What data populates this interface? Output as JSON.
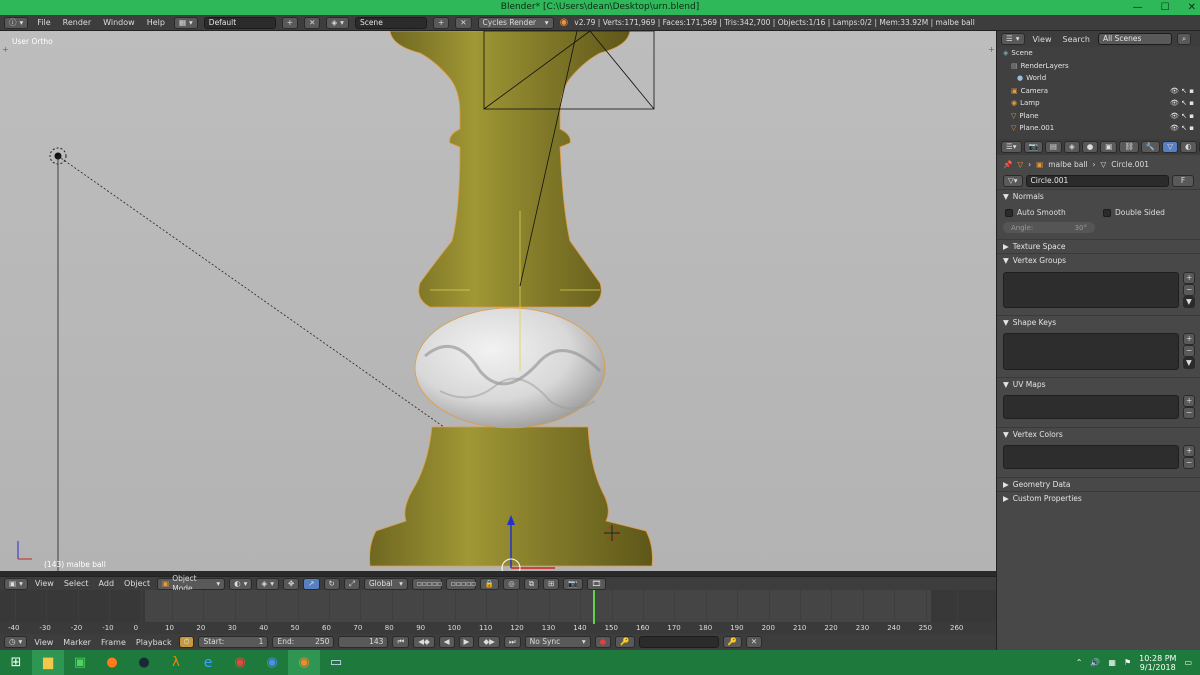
{
  "window": {
    "title": "Blender* [C:\\Users\\dean\\Desktop\\urn.blend]",
    "minimize": "—",
    "maximize": "☐",
    "close": "✕"
  },
  "infobar": {
    "menus": [
      "File",
      "Render",
      "Window",
      "Help"
    ],
    "layout": "Default",
    "scene": "Scene",
    "engine": "Cycles Render",
    "stats": "v2.79 | Verts:171,969 | Faces:171,569 | Tris:342,700 | Objects:1/16 | Lamps:0/2 | Mem:33.92M | malbe ball"
  },
  "viewport": {
    "view_label": "User Ortho",
    "object_label": "(143) malbe ball"
  },
  "outliner": {
    "view": "View",
    "search": "Search",
    "filter": "All Scenes",
    "items": [
      "Scene",
      "RenderLayers",
      "World",
      "Camera",
      "Lamp",
      "Plane",
      "Plane.001"
    ]
  },
  "properties": {
    "breadcrumb_object": "malbe ball",
    "breadcrumb_data": "Circle.001",
    "data_name": "Circle.001",
    "fake_user": "F",
    "normals": "Normals",
    "auto_smooth": "Auto Smooth",
    "double_sided": "Double Sided",
    "angle_label": "Angle:",
    "angle_value": "30°",
    "texture_space": "Texture Space",
    "vertex_groups": "Vertex Groups",
    "shape_keys": "Shape Keys",
    "uv_maps": "UV Maps",
    "vertex_colors": "Vertex Colors",
    "geometry_data": "Geometry Data",
    "custom_properties": "Custom Properties"
  },
  "viewport_header": {
    "menus": [
      "View",
      "Select",
      "Add",
      "Object"
    ],
    "mode": "Object Mode",
    "orientation": "Global"
  },
  "timeline": {
    "ticks": [
      "-40",
      "-30",
      "-20",
      "-10",
      "0",
      "10",
      "20",
      "30",
      "40",
      "50",
      "60",
      "70",
      "80",
      "90",
      "100",
      "110",
      "120",
      "130",
      "140",
      "150",
      "160",
      "170",
      "180",
      "190",
      "200",
      "210",
      "220",
      "230",
      "240",
      "250",
      "260"
    ],
    "current_frame_marker": 143
  },
  "timeline_header": {
    "menus": [
      "View",
      "Marker",
      "Frame",
      "Playback"
    ],
    "start_label": "Start:",
    "start_value": "1",
    "end_label": "End:",
    "end_value": "250",
    "current": "143",
    "sync": "No Sync"
  },
  "taskbar": {
    "time": "10:28 PM",
    "date": "9/1/2018"
  },
  "colors": {
    "gold": "#8e8430",
    "titlebar": "#2fb85a",
    "taskbar": "#1d7a3c",
    "select_blue": "#5680c2"
  }
}
